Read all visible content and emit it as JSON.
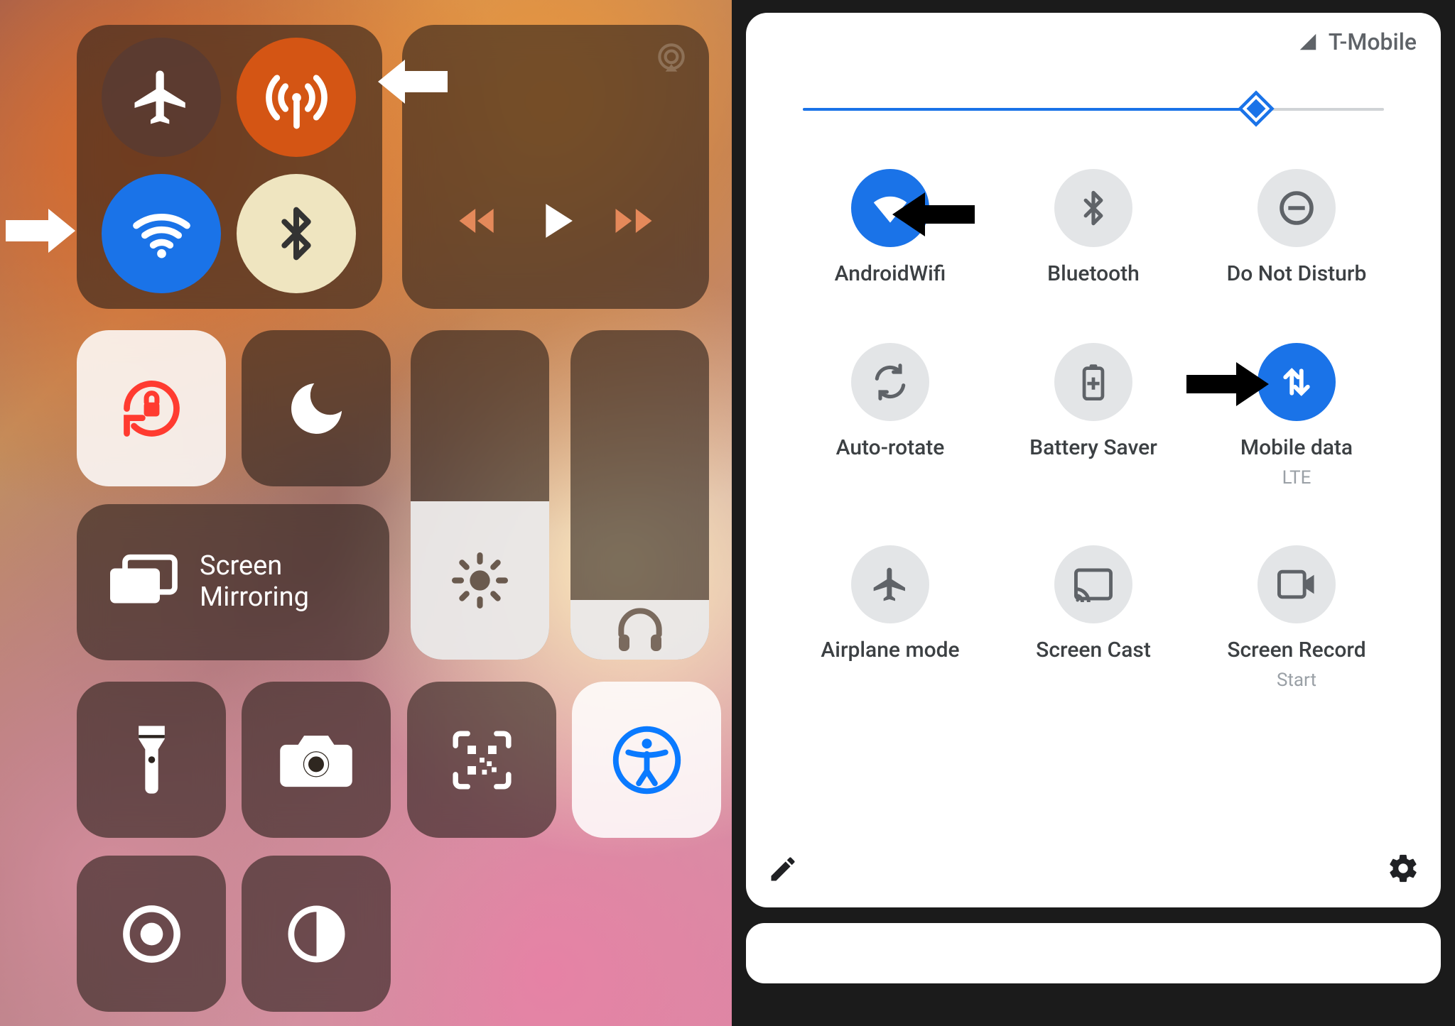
{
  "ios": {
    "screen_mirroring_label": "Screen\nMirroring",
    "toggles": {
      "airplane": "airplane",
      "cellular": "cellular",
      "wifi": "wifi",
      "bluetooth": "bluetooth"
    },
    "brightness_pct": 48,
    "volume_pct": 18
  },
  "android": {
    "carrier": "T-Mobile",
    "brightness_pct": 78,
    "tiles": [
      {
        "id": "wifi",
        "label": "AndroidWifi",
        "sub": "",
        "on": true
      },
      {
        "id": "bluetooth",
        "label": "Bluetooth",
        "sub": "",
        "on": false
      },
      {
        "id": "dnd",
        "label": "Do Not Disturb",
        "sub": "",
        "on": false
      },
      {
        "id": "autorotate",
        "label": "Auto-rotate",
        "sub": "",
        "on": false
      },
      {
        "id": "batterysaver",
        "label": "Battery Saver",
        "sub": "",
        "on": false
      },
      {
        "id": "mobiledata",
        "label": "Mobile data",
        "sub": "LTE",
        "on": true
      },
      {
        "id": "airplane",
        "label": "Airplane mode",
        "sub": "",
        "on": false
      },
      {
        "id": "screencast",
        "label": "Screen Cast",
        "sub": "",
        "on": false
      },
      {
        "id": "screenrecord",
        "label": "Screen Record",
        "sub": "Start",
        "on": false
      }
    ]
  }
}
